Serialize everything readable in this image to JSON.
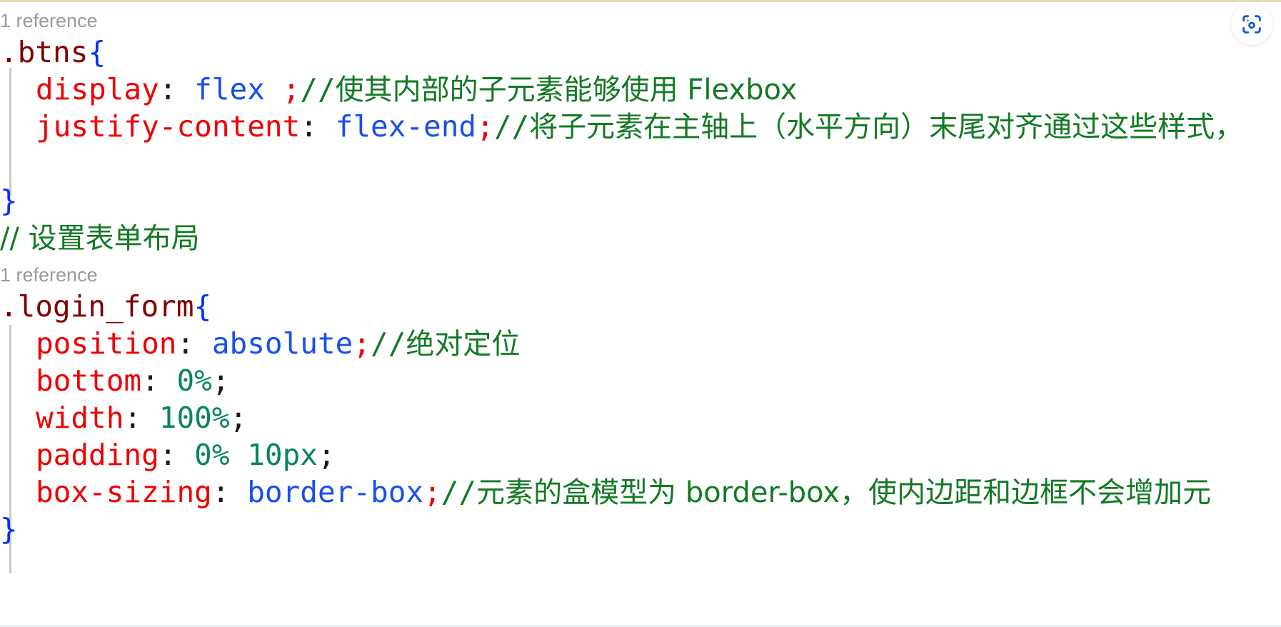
{
  "editor": {
    "language": "scss",
    "background_color": "#ffffff",
    "top_rule_color": "#ecd9ae",
    "bottom_rule_color": "#eceff1",
    "indent_guide_color": "#c8c8c8",
    "codelens_color": "#9a9a9a"
  },
  "colors": {
    "selector": "#800000",
    "brace": "#0431fa",
    "property": "#ef0000",
    "punctuation": "#1a1a1a",
    "value_keyword": "#1750eb",
    "value_number": "#098658",
    "comment": "#137a24",
    "accent_icon": "#0a5bc4"
  },
  "toolbar": {
    "scan_icon": "scan-camera-icon",
    "scan_icon_color": "#0a5bc4"
  },
  "codelens": {
    "btns_reference": "1 reference",
    "login_form_reference": "1 reference"
  },
  "code": {
    "btns_rule": {
      "selector": ".btns",
      "open_brace": "{",
      "close_brace": "}",
      "declarations": [
        {
          "property": "display",
          "colon": ": ",
          "value": "flex ",
          "semicolon": ";",
          "comment_slashes": "//",
          "comment_text": "使其内部的子元素能够使用 Flexbox"
        },
        {
          "property": "justify-content",
          "colon": ": ",
          "value": "flex-end",
          "semicolon": ";",
          "comment_slashes": "//",
          "comment_text": "将子元素在主轴上（水平方向）末尾对齐通过这些样式，"
        }
      ]
    },
    "section_comment": "// 设置表单布局",
    "login_form_rule": {
      "selector": ".login_form",
      "open_brace": "{",
      "close_brace": "}",
      "declarations": [
        {
          "property": "position",
          "colon": ": ",
          "value": "absolute",
          "semicolon": ";",
          "comment_slashes": "//",
          "comment_text": "绝对定位"
        },
        {
          "property": "bottom",
          "colon": ": ",
          "value": "0%",
          "semicolon": ";",
          "comment_slashes": "",
          "comment_text": ""
        },
        {
          "property": "width",
          "colon": ": ",
          "value": "100%",
          "semicolon": ";",
          "comment_slashes": "",
          "comment_text": ""
        },
        {
          "property": "padding",
          "colon": ": ",
          "value": "0% 10px",
          "semicolon": ";",
          "comment_slashes": "",
          "comment_text": ""
        },
        {
          "property": "box-sizing",
          "colon": ": ",
          "value": "border-box",
          "semicolon": ";",
          "comment_slashes": "//",
          "comment_text": "元素的盒模型为 border-box，使内边距和边框不会增加元"
        }
      ]
    }
  }
}
